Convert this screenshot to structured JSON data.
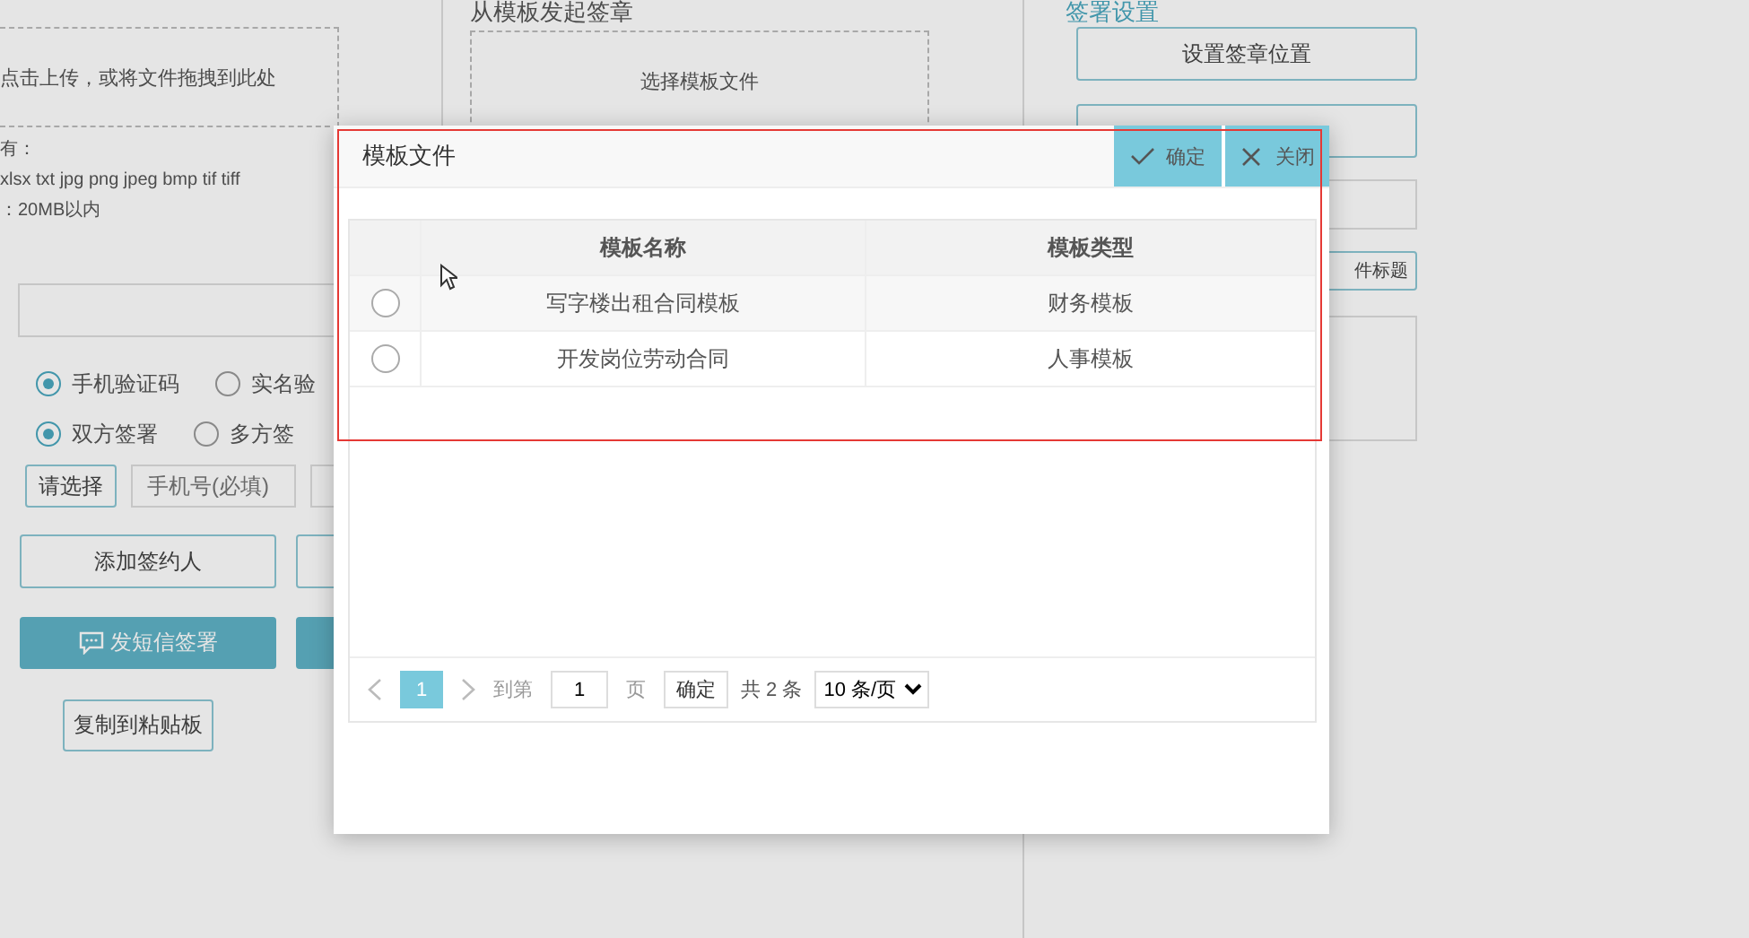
{
  "background": {
    "upload": {
      "hint": "点击上传，或将文件拖拽到此处",
      "formats_label": "有：",
      "formats": "xlsx txt jpg png jpeg bmp tif tiff",
      "size_limit": "：20MB以内"
    },
    "verify_options": [
      {
        "label": "手机验证码",
        "selected": true
      },
      {
        "label": "实名验",
        "selected": false
      }
    ],
    "sign_options": [
      {
        "label": "双方签署",
        "selected": true
      },
      {
        "label": "多方签",
        "selected": false
      }
    ],
    "choose_button": "请选择",
    "phone_field": {
      "placeholder": "手机号(必填)"
    },
    "add_signer_button": "添加签约人",
    "sms_sign_button": "发短信签署",
    "copy_button": "复制到粘贴板",
    "template_section": {
      "title": "从模板发起签章",
      "picker": "选择模板文件"
    },
    "settings": {
      "title": "签署设置",
      "position_button": "设置签章位置",
      "attachment_title_button": "件标题"
    }
  },
  "dialog": {
    "title": "模板文件",
    "buttons": [
      {
        "kind": "confirm",
        "label": "确定"
      },
      {
        "kind": "close",
        "label": "关闭"
      }
    ],
    "table": {
      "columns": [
        "模板名称",
        "模板类型"
      ],
      "rows": [
        {
          "selected": false,
          "name": "写字楼出租合同模板",
          "type": "财务模板"
        },
        {
          "selected": false,
          "name": "开发岗位劳动合同",
          "type": "人事模板"
        }
      ]
    },
    "pagination": {
      "pages": [
        {
          "label": "1",
          "selected": true
        }
      ],
      "goto_label": "到第",
      "goto_value": "1",
      "page_unit": "页",
      "go_button": "确定",
      "total": "共 2 条",
      "page_size": "10 条/页"
    }
  }
}
